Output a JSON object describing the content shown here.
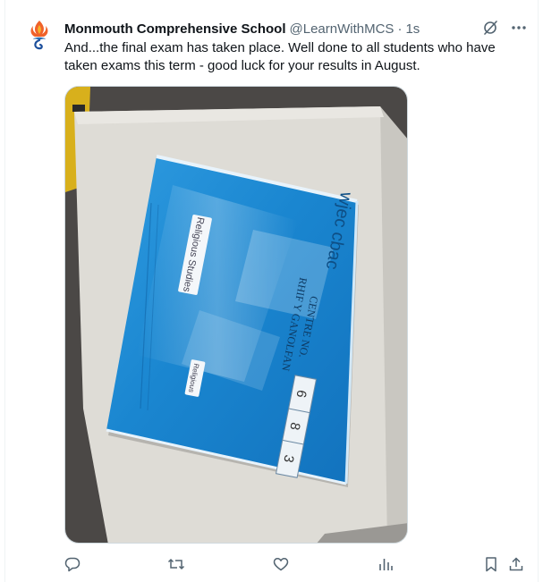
{
  "tweet": {
    "author_name": "Monmouth Comprehensive School",
    "handle": "@LearnWithMCS",
    "separator": "·",
    "time": "1s",
    "text": "And...the final exam has taken place.  Well done to all students who have taken exams this term - good luck for your results in August."
  },
  "media": {
    "bag_text": {
      "brand": "wjec cbac",
      "centre_label_en": "CENTRE NO.",
      "centre_label_cy": "RHIF Y GANOLFAN",
      "centre_digits": [
        "6",
        "8",
        "3"
      ],
      "label_1": "Religious Studies",
      "label_2": "Religious"
    }
  },
  "icons": {
    "top": [
      "grok-icon",
      "more-icon"
    ],
    "bottom": [
      "reply-icon",
      "retweet-icon",
      "like-icon",
      "views-icon",
      "bookmark-icon",
      "share-icon"
    ]
  },
  "colors": {
    "text": "#0f1419",
    "secondary": "#536471",
    "bag_blue": "#1e8ad3",
    "border": "#cfd9de"
  }
}
